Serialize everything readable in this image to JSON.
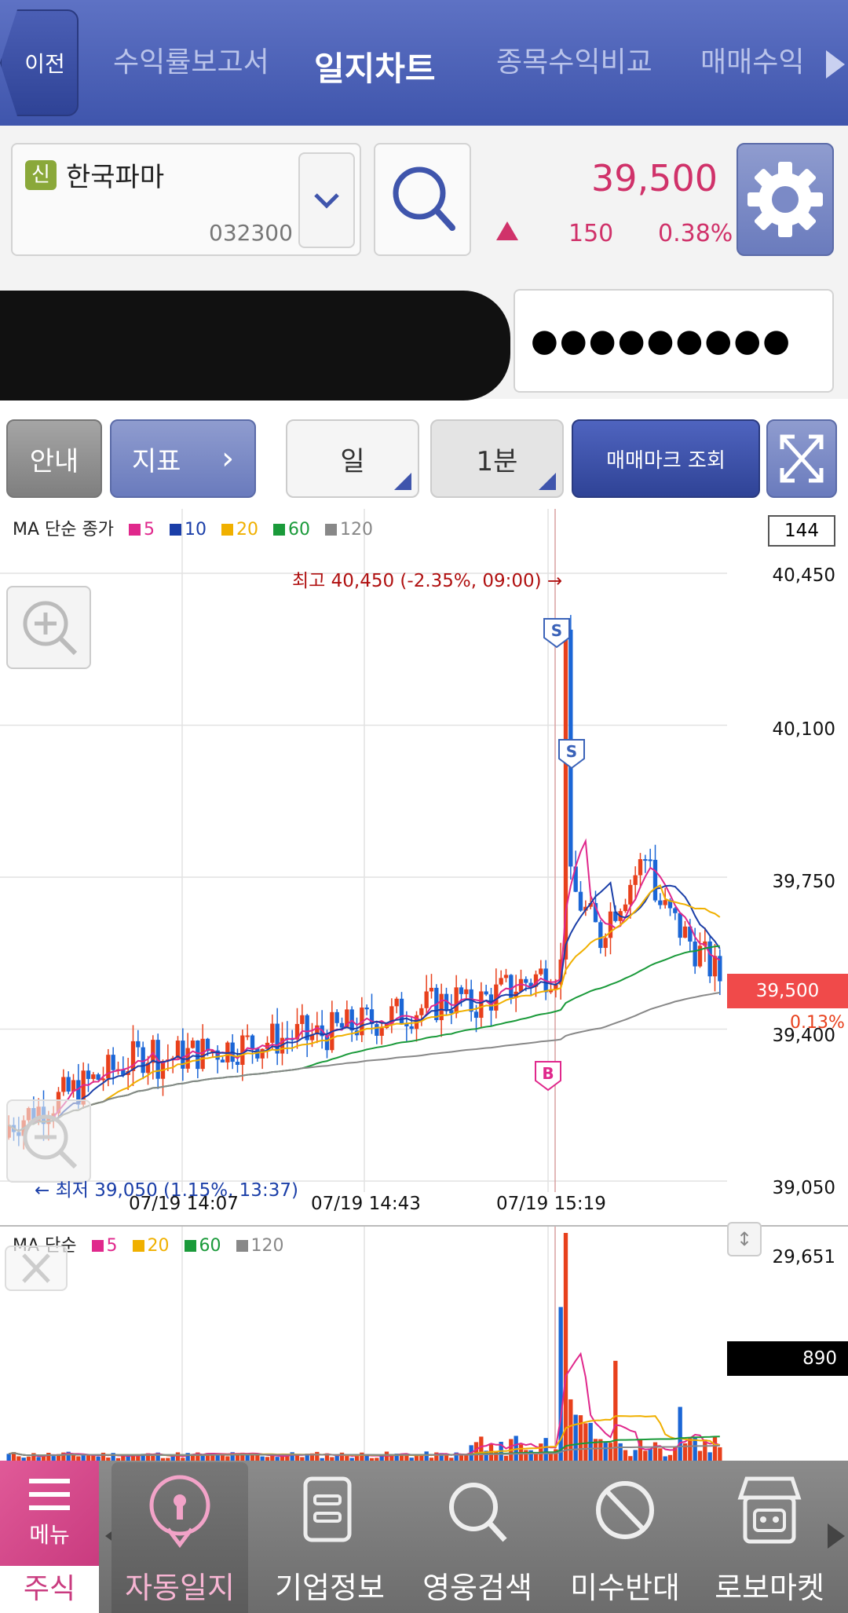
{
  "topnav": {
    "back_label": "이전",
    "tabs": [
      "수익률보고서",
      "일지차트",
      "종목수익비교",
      "매매수익"
    ],
    "active_tab": "일지차트"
  },
  "stock": {
    "badge": "신",
    "name": "한국파마",
    "code": "032300",
    "price": "39,500",
    "change": "150",
    "change_pct": "0.38%"
  },
  "account": {
    "masked_password": "●●●●●●●●●"
  },
  "toolbar": {
    "info_label": "안내",
    "indicator_label": "지표",
    "period_label": "일",
    "interval_label": "1분",
    "trade_mark_label": "매매마크 조회"
  },
  "chart": {
    "legend_title": "MA 단순 종가",
    "legend_items": [
      "5",
      "10",
      "20",
      "60",
      "120"
    ],
    "count_box": "144",
    "high_annotation": "최고 40,450 (-2.35%, 09:00)",
    "low_annotation": "최저 39,050 (1.15%, 13:37)",
    "current_price_tag": "39,500",
    "current_pct_tag": "0.13%",
    "sell_marker": "S",
    "buy_marker": "B"
  },
  "volume": {
    "legend_title": "MA 단순",
    "legend_items": [
      "5",
      "20",
      "60",
      "120"
    ],
    "max_label": "29,651",
    "current_label": "890"
  },
  "bottomnav": {
    "menu_label": "메뉴",
    "stock_label": "주식",
    "items": [
      "자동일지",
      "기업정보",
      "영웅검색",
      "미수반대",
      "로보마켓"
    ]
  },
  "colors": {
    "ma5": "#e0288c",
    "ma10": "#1a3ea8",
    "ma20": "#f0b000",
    "ma60": "#1a9a3a",
    "ma120": "#888888",
    "up": "#e8401c",
    "down": "#1b66d6",
    "accent": "#3f55ac"
  },
  "chart_data": {
    "type": "candlestick",
    "yticks": [
      40450,
      40100,
      39750,
      39400,
      39050
    ],
    "xticks": [
      "07/19 14:07",
      "07/19 14:43",
      "07/19 15:19"
    ],
    "ylim": [
      39050,
      40450
    ],
    "high": 40450,
    "low": 39050,
    "last": 39500,
    "volume_max": 29651,
    "volume_last": 890
  }
}
